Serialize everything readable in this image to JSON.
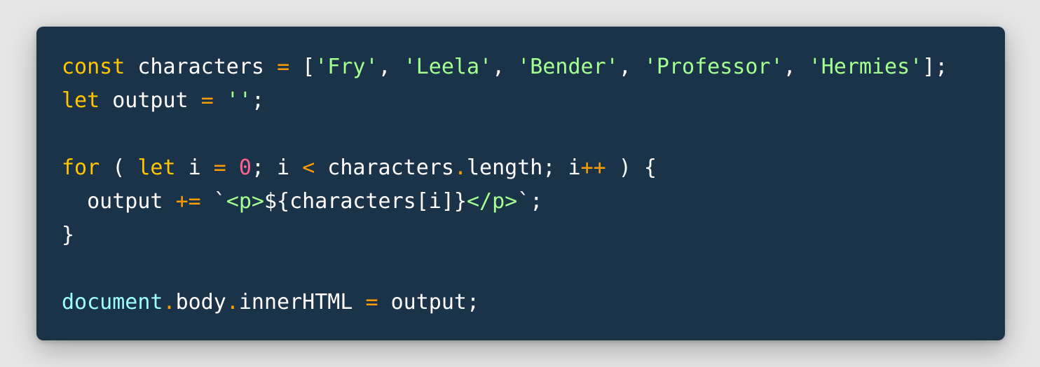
{
  "theme": {
    "background": "#e6e6e6",
    "editor_background": "#1b3349",
    "keyword": "#ffc600",
    "operator": "#ff9d00",
    "string": "#a5ff90",
    "number": "#ff628c",
    "global": "#9effff",
    "text": "#ffffff"
  },
  "code": {
    "language": "javascript",
    "lines": [
      [
        {
          "t": "keyword",
          "v": "const"
        },
        {
          "t": "ident",
          "v": " characters "
        },
        {
          "t": "operator",
          "v": "="
        },
        {
          "t": "punct",
          "v": " ["
        },
        {
          "t": "string",
          "v": "'Fry'"
        },
        {
          "t": "punct",
          "v": ", "
        },
        {
          "t": "string",
          "v": "'Leela'"
        },
        {
          "t": "punct",
          "v": ", "
        },
        {
          "t": "string",
          "v": "'Bender'"
        },
        {
          "t": "punct",
          "v": ", "
        },
        {
          "t": "string",
          "v": "'Professor'"
        },
        {
          "t": "punct",
          "v": ", "
        },
        {
          "t": "string",
          "v": "'Hermies'"
        },
        {
          "t": "punct",
          "v": "];"
        }
      ],
      [
        {
          "t": "keyword",
          "v": "let"
        },
        {
          "t": "ident",
          "v": " output "
        },
        {
          "t": "operator",
          "v": "="
        },
        {
          "t": "punct",
          "v": " "
        },
        {
          "t": "string",
          "v": "''"
        },
        {
          "t": "punct",
          "v": ";"
        }
      ],
      [],
      [
        {
          "t": "keyword",
          "v": "for"
        },
        {
          "t": "punct",
          "v": " ( "
        },
        {
          "t": "keyword",
          "v": "let"
        },
        {
          "t": "ident",
          "v": " i "
        },
        {
          "t": "operator",
          "v": "="
        },
        {
          "t": "punct",
          "v": " "
        },
        {
          "t": "number",
          "v": "0"
        },
        {
          "t": "punct",
          "v": "; i "
        },
        {
          "t": "operator",
          "v": "<"
        },
        {
          "t": "ident",
          "v": " characters"
        },
        {
          "t": "operator",
          "v": "."
        },
        {
          "t": "ident",
          "v": "length"
        },
        {
          "t": "punct",
          "v": "; i"
        },
        {
          "t": "operator",
          "v": "++"
        },
        {
          "t": "punct",
          "v": " ) {"
        }
      ],
      [
        {
          "t": "ident",
          "v": "  output "
        },
        {
          "t": "operator",
          "v": "+="
        },
        {
          "t": "punct",
          "v": " `"
        },
        {
          "t": "tag",
          "v": "<p>"
        },
        {
          "t": "punct",
          "v": "${characters[i]}"
        },
        {
          "t": "tag",
          "v": "</p>"
        },
        {
          "t": "punct",
          "v": "`;"
        }
      ],
      [
        {
          "t": "punct",
          "v": "}"
        }
      ],
      [],
      [
        {
          "t": "global",
          "v": "document"
        },
        {
          "t": "operator",
          "v": "."
        },
        {
          "t": "ident",
          "v": "body"
        },
        {
          "t": "operator",
          "v": "."
        },
        {
          "t": "ident",
          "v": "innerHTML "
        },
        {
          "t": "operator",
          "v": "="
        },
        {
          "t": "ident",
          "v": " output"
        },
        {
          "t": "punct",
          "v": ";"
        }
      ]
    ]
  }
}
